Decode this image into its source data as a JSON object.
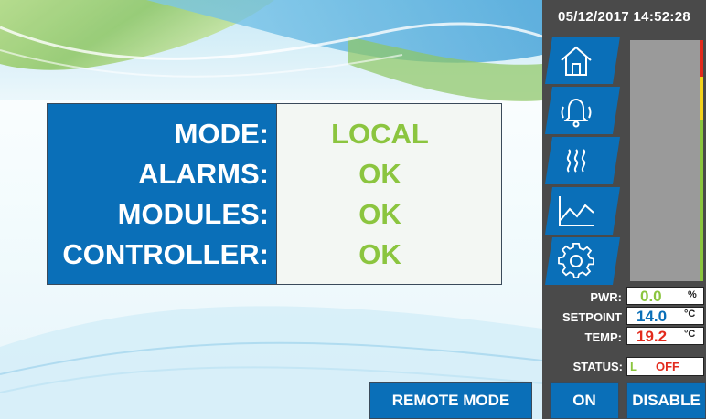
{
  "header": {
    "datetime": "05/12/2017 14:52:28"
  },
  "status": {
    "rows": [
      {
        "label": "MODE:",
        "value": "LOCAL"
      },
      {
        "label": "ALARMS:",
        "value": "OK"
      },
      {
        "label": "MODULES:",
        "value": "OK"
      },
      {
        "label": "CONTROLLER:",
        "value": "OK"
      }
    ]
  },
  "nav": {
    "items": [
      {
        "icon": "home-icon"
      },
      {
        "icon": "alarm-bell-icon"
      },
      {
        "icon": "heater-icon"
      },
      {
        "icon": "trend-chart-icon"
      },
      {
        "icon": "settings-gear-icon"
      }
    ]
  },
  "gauge": {
    "level_percent": 0
  },
  "readouts": {
    "pwr": {
      "label": "PWR:",
      "value": "0.0",
      "unit": "%",
      "color": "#8bc53f"
    },
    "setpoint": {
      "label": "SETPOINT",
      "value": "14.0",
      "unit": "°C",
      "color": "#0a6fb8"
    },
    "temp": {
      "label": "TEMP:",
      "value": "19.2",
      "unit": "°C",
      "color": "#e32b1d"
    }
  },
  "status_line": {
    "label": "STATUS:",
    "mode_letter": "L",
    "value": "OFF"
  },
  "buttons": {
    "remote_mode": "REMOTE MODE",
    "on": "ON",
    "disable": "DISABLE"
  },
  "colors": {
    "accent": "#0a6fb8",
    "ok": "#8bc53f",
    "alert": "#e32b1d",
    "panel": "#4a4a4a"
  }
}
